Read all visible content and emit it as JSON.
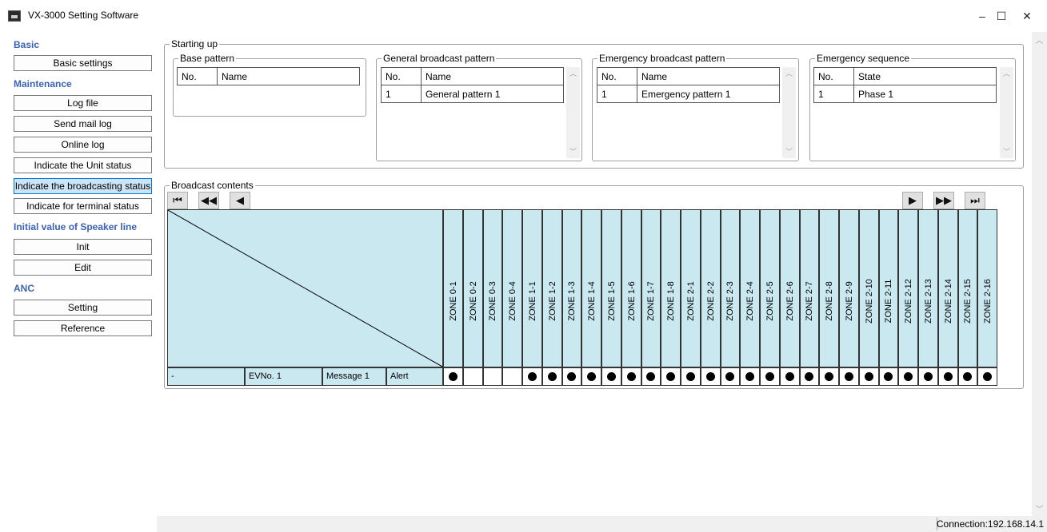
{
  "window": {
    "title": "VX-3000 Setting Software",
    "minimize": "–",
    "maximize": "☐",
    "close": "✕"
  },
  "sidebar": {
    "sections": [
      {
        "heading": "Basic",
        "buttons": [
          "Basic settings"
        ]
      },
      {
        "heading": "Maintenance",
        "buttons": [
          "Log file",
          "Send mail log",
          "Online log",
          "Indicate the Unit status",
          "Indicate the broadcasting status",
          "Indicate for terminal status"
        ]
      },
      {
        "heading": "Initial value of Speaker line",
        "buttons": [
          "Init",
          "Edit"
        ]
      },
      {
        "heading": "ANC",
        "buttons": [
          "Setting",
          "Reference"
        ]
      }
    ],
    "active_button": "Indicate the broadcasting status"
  },
  "starting_up": {
    "title": "Starting up",
    "base_pattern": {
      "title": "Base pattern",
      "col1": "No.",
      "col2": "Name",
      "rows": []
    },
    "general_pattern": {
      "title": "General broadcast pattern",
      "col1": "No.",
      "col2": "Name",
      "rows": [
        {
          "no": "1",
          "name": "General pattern 1"
        }
      ]
    },
    "emergency_pattern": {
      "title": "Emergency broadcast pattern",
      "col1": "No.",
      "col2": "Name",
      "rows": [
        {
          "no": "1",
          "name": "Emergency pattern 1"
        }
      ]
    },
    "emergency_sequence": {
      "title": "Emergency sequence",
      "col1": "No.",
      "col2": "State",
      "rows": [
        {
          "no": "1",
          "name": "Phase 1"
        }
      ]
    }
  },
  "broadcast": {
    "title": "Broadcast contents",
    "nav_left": [
      "⏮",
      "◀◀",
      "◀"
    ],
    "nav_right": [
      "▶",
      "▶▶",
      "⏭"
    ],
    "zones": [
      "ZONE 0-1",
      "ZONE 0-2",
      "ZONE 0-3",
      "ZONE 0-4",
      "ZONE 1-1",
      "ZONE 1-2",
      "ZONE 1-3",
      "ZONE 1-4",
      "ZONE 1-5",
      "ZONE 1-6",
      "ZONE 1-7",
      "ZONE 1-8",
      "ZONE 2-1",
      "ZONE 2-2",
      "ZONE 2-3",
      "ZONE 2-4",
      "ZONE 2-5",
      "ZONE 2-6",
      "ZONE 2-7",
      "ZONE 2-8",
      "ZONE 2-9",
      "ZONE 2-10",
      "ZONE 2-11",
      "ZONE 2-12",
      "ZONE 2-13",
      "ZONE 2-14",
      "ZONE 2-15",
      "ZONE 2-16"
    ],
    "row": {
      "col_a": "-",
      "ev_no": "EVNo. 1",
      "message": "Message 1",
      "type": "Alert"
    },
    "active": [
      true,
      false,
      false,
      false,
      true,
      true,
      true,
      true,
      true,
      true,
      true,
      true,
      true,
      true,
      true,
      true,
      true,
      true,
      true,
      true,
      true,
      true,
      true,
      true,
      true,
      true,
      true,
      true
    ]
  },
  "status": {
    "connection": "Connection:192.168.14.1"
  }
}
